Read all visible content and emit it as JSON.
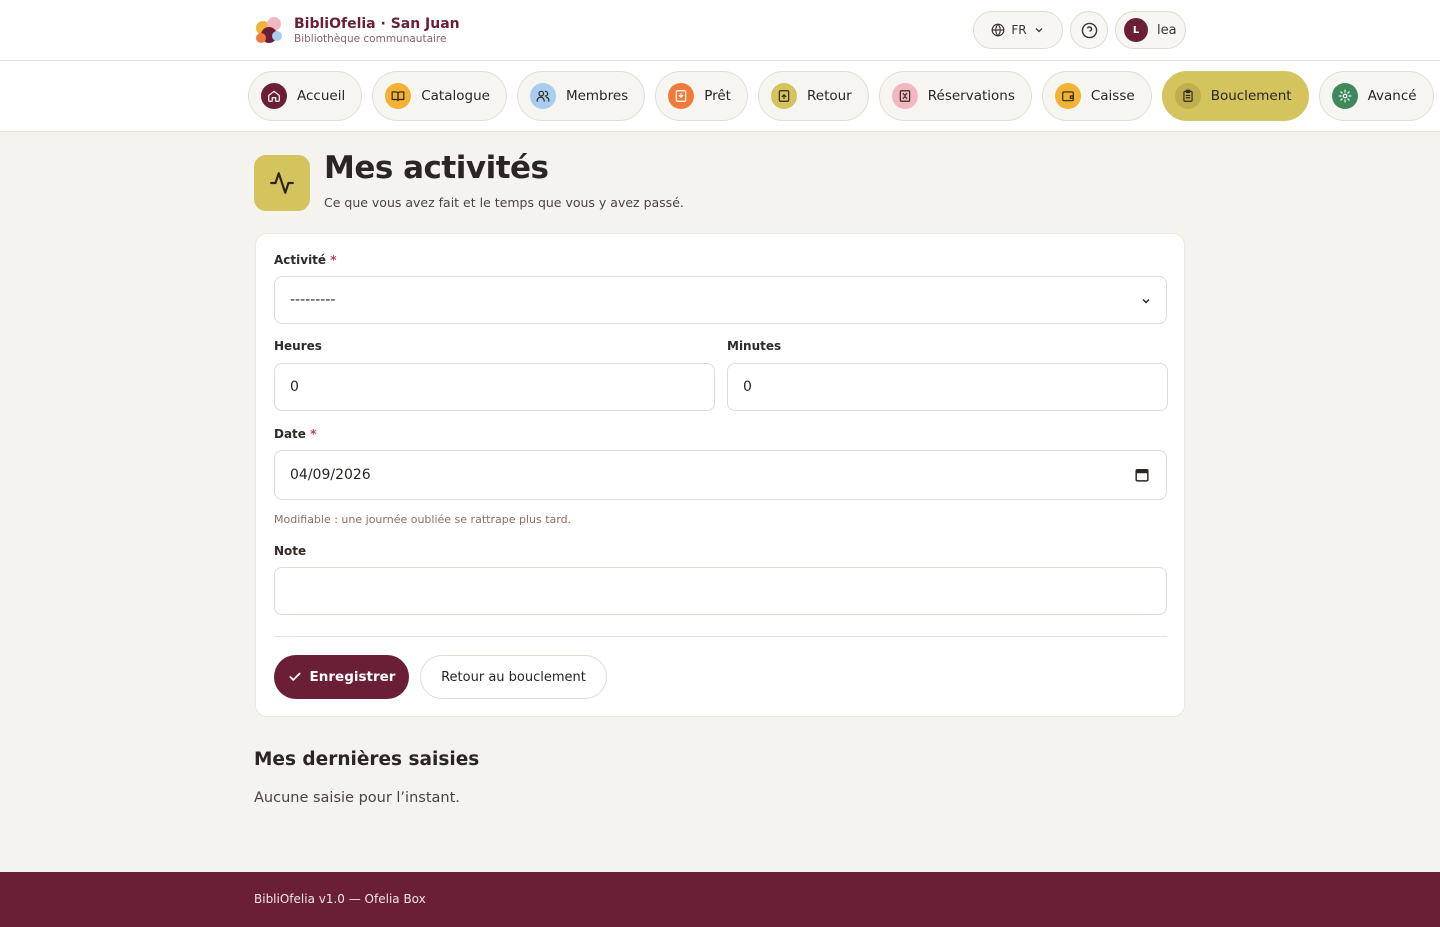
{
  "header": {
    "brand_title": "BibliOfelia · San Juan",
    "brand_subtitle": "Bibliothèque communautaire",
    "language": "FR",
    "user_initial": "L",
    "user_name": "lea"
  },
  "nav": {
    "tabs": [
      {
        "label": "Accueil",
        "icon": "home-icon",
        "color": "#6b1f37"
      },
      {
        "label": "Catalogue",
        "icon": "book-icon",
        "color": "#f2b233"
      },
      {
        "label": "Membres",
        "icon": "users-icon",
        "color": "#a9cdee"
      },
      {
        "label": "Prêt",
        "icon": "loan-icon",
        "color": "#ef7a3a"
      },
      {
        "label": "Retour",
        "icon": "return-icon",
        "color": "#d4c45e"
      },
      {
        "label": "Réservations",
        "icon": "bookmark-icon",
        "color": "#f2b8bf"
      },
      {
        "label": "Caisse",
        "icon": "wallet-icon",
        "color": "#f2b233"
      },
      {
        "label": "Bouclement",
        "icon": "clipboard-icon",
        "color": "#bfae4c",
        "active": true
      },
      {
        "label": "Avancé",
        "icon": "gear-icon",
        "color": "#3f8a5a"
      }
    ]
  },
  "page": {
    "title": "Mes activités",
    "subtitle": "Ce que vous avez fait et le temps que vous y avez passé."
  },
  "form": {
    "activity_label": "Activité",
    "activity_value": "---------",
    "hours_label": "Heures",
    "hours_value": "0",
    "minutes_label": "Minutes",
    "minutes_value": "0",
    "date_label": "Date",
    "date_value": "04/09/2026",
    "date_hint": "Modifiable : une journée oubliée se rattrape plus tard.",
    "note_label": "Note",
    "note_value": "",
    "required_mark": "*",
    "save_label": "Enregistrer",
    "back_label": "Retour au bouclement"
  },
  "recent": {
    "title": "Mes dernières saisies",
    "empty": "Aucune saisie pour l’instant."
  },
  "footer": {
    "text": "BibliOfelia v1.0 — Ofelia Box"
  },
  "colors": {
    "brand": "#6b1f37",
    "accent": "#d4c45e",
    "background": "#f4f3ee"
  }
}
